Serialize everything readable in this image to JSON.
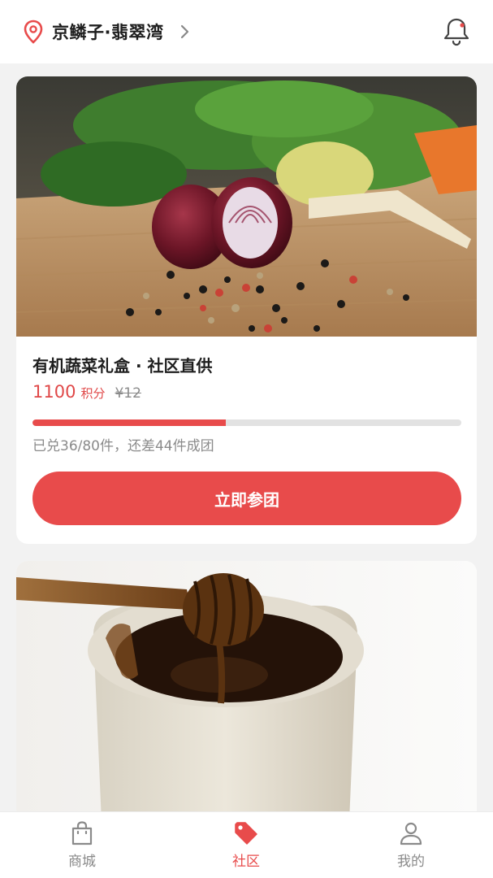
{
  "header": {
    "location": "京鳞子·翡翠湾",
    "location_icon": "map-pin-icon",
    "notification_icon": "bell-icon"
  },
  "products": [
    {
      "title": "有机蔬菜礼盒 · 社区直供",
      "points": "1100",
      "points_unit": "积分",
      "original_price": "¥12",
      "progress_fraction": 0.45,
      "progress_text": "已兑36/80件，还差44件成团",
      "join_label": "立即参团",
      "image": "vegetables-onion-peppercorns-photo"
    },
    {
      "image": "honey-jar-dipper-photo"
    }
  ],
  "tabbar": {
    "tabs": [
      {
        "label": "商城",
        "icon": "shopping-bag-icon",
        "active": false
      },
      {
        "label": "社区",
        "icon": "tag-icon",
        "active": true
      },
      {
        "label": "我的",
        "icon": "user-icon",
        "active": false
      }
    ]
  },
  "colors": {
    "accent": "#e84b4b",
    "background": "#f2f2f2"
  }
}
